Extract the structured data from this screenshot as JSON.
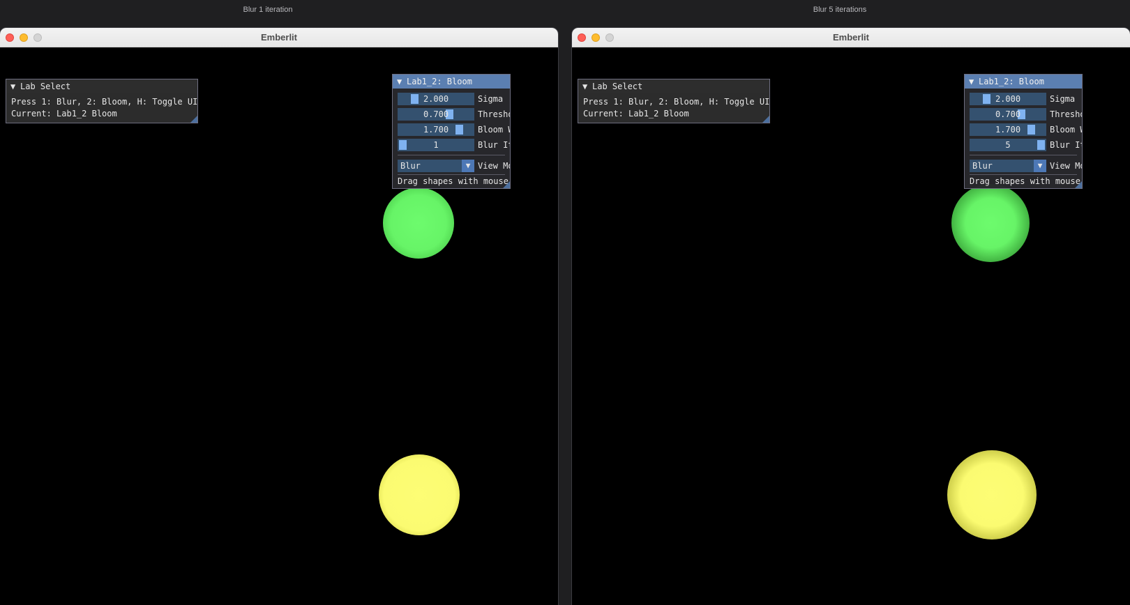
{
  "captions": {
    "left": "Blur 1 iteration",
    "right": "Blur 5 iterations"
  },
  "windows": [
    {
      "title": "Emberlit",
      "lab_select": {
        "header": "Lab Select",
        "line1": "Press 1: Blur, 2: Bloom, H: Toggle UI",
        "line2": "Current: Lab1_2 Bloom"
      },
      "bloom_panel": {
        "header": "Lab1_2: Bloom",
        "sliders": [
          {
            "value": "2.000",
            "label": "Sigma",
            "level": 0.18
          },
          {
            "value": "0.700",
            "label": "Threshold",
            "level": 0.7
          },
          {
            "value": "1.700",
            "label": "Bloom W",
            "level": 0.85
          },
          {
            "value": "1",
            "label": "Blur It",
            "level": 0.0
          }
        ],
        "view_mode": {
          "value": "Blur",
          "label": "View Mo"
        },
        "hint": "Drag shapes with mouse"
      }
    },
    {
      "title": "Emberlit",
      "lab_select": {
        "header": "Lab Select",
        "line1": "Press 1: Blur, 2: Bloom, H: Toggle UI",
        "line2": "Current: Lab1_2 Bloom"
      },
      "bloom_panel": {
        "header": "Lab1_2: Bloom",
        "sliders": [
          {
            "value": "2.000",
            "label": "Sigma",
            "level": 0.18
          },
          {
            "value": "0.700",
            "label": "Threshold",
            "level": 0.7
          },
          {
            "value": "1.700",
            "label": "Bloom W",
            "level": 0.85
          },
          {
            "value": "5",
            "label": "Blur It",
            "level": 1.0
          }
        ],
        "view_mode": {
          "value": "Blur",
          "label": "View Mo"
        },
        "hint": "Drag shapes with mouse"
      }
    }
  ],
  "icons": {
    "collapse_arrow": "▼",
    "combo_arrow": "▼"
  },
  "colors": {
    "green_shape": "#6dfb6d",
    "yellow_shape": "#fdfd75",
    "imgui_accent": "#5b7fb1",
    "slider_grab": "#7fb2f0"
  }
}
